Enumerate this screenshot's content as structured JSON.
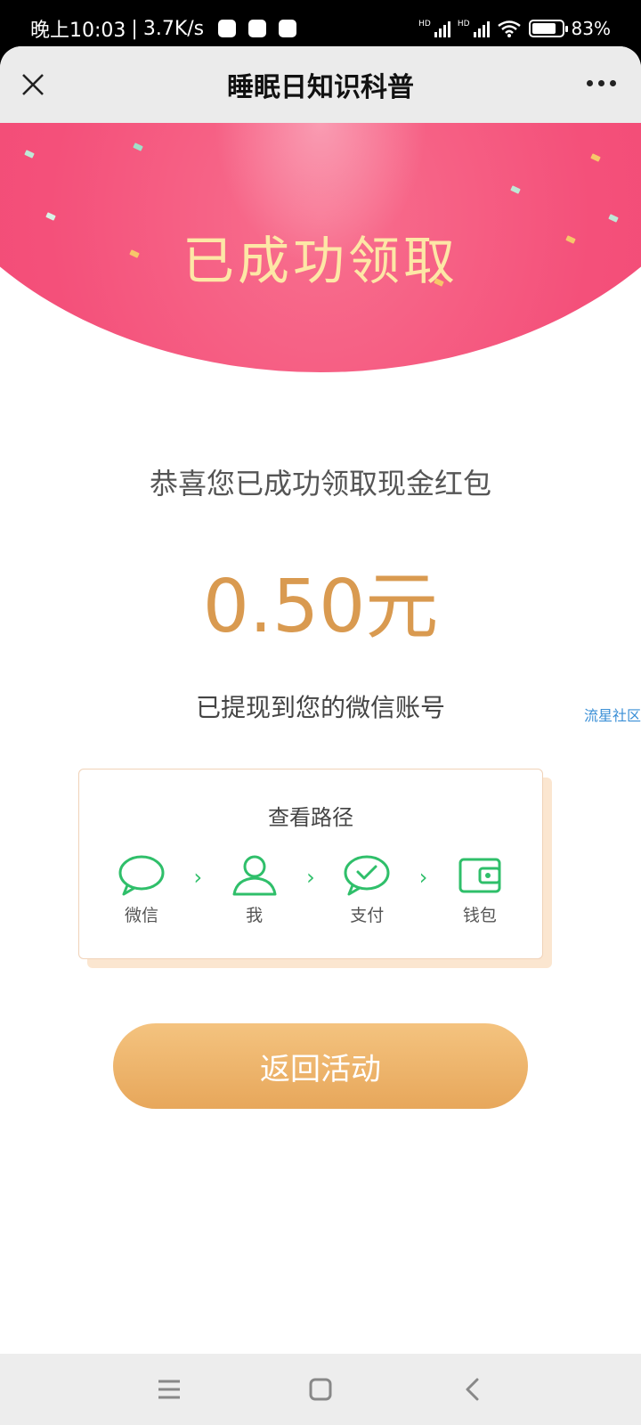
{
  "status_bar": {
    "time": "晚上10:03",
    "net_speed": "3.7K/s",
    "hd_label": "HD",
    "battery": "83%",
    "battery_level": 0.83
  },
  "nav": {
    "title": "睡眠日知识科普",
    "close_icon": "close-icon",
    "more_icon": "more-icon"
  },
  "hero": {
    "title": "已成功领取",
    "colors": {
      "primary": "#ef4470",
      "title": "#fde7a6"
    }
  },
  "result": {
    "message": "恭喜您已成功领取现金红包",
    "amount": "0.50元",
    "sub_message": "已提现到您的微信账号"
  },
  "watermark": "流星社区",
  "path_card": {
    "title": "查看路径",
    "steps": [
      {
        "label": "微信",
        "icon": "wechat-chat-icon"
      },
      {
        "label": "我",
        "icon": "user-icon"
      },
      {
        "label": "支付",
        "icon": "pay-check-icon"
      },
      {
        "label": "钱包",
        "icon": "wallet-icon"
      }
    ],
    "accent": "#2fbf6a"
  },
  "button": {
    "label": "返回活动",
    "color": "#e7a75b"
  },
  "system_nav": [
    "menu-icon",
    "home-icon",
    "back-icon"
  ]
}
